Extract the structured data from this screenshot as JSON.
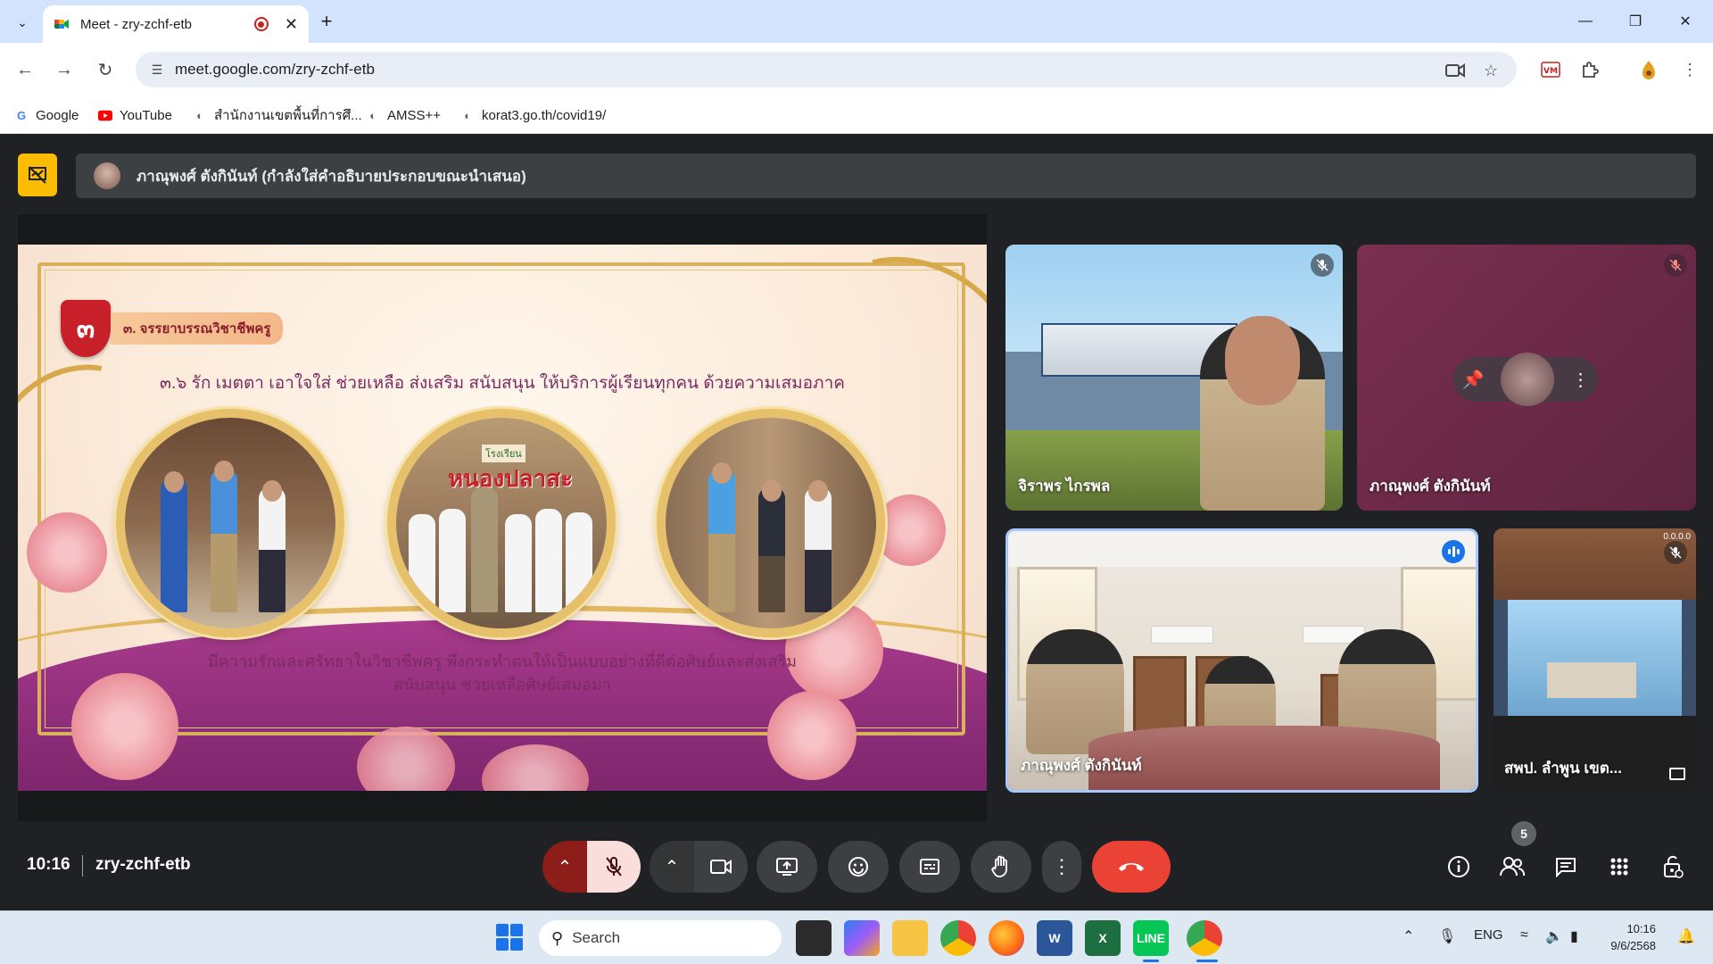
{
  "browser": {
    "tab_title": "Meet - zry-zchf-etb",
    "new_tab": "+",
    "url": "meet.google.com/zry-zchf-etb",
    "bookmarks": [
      {
        "label": "Google",
        "icon": "google-icon"
      },
      {
        "label": "YouTube",
        "icon": "youtube-icon"
      },
      {
        "label": "สำนักงานเขตพื้นที่การศึ...",
        "icon": "globe-icon"
      },
      {
        "label": "AMSS++",
        "icon": "globe-icon"
      },
      {
        "label": "korat3.go.th/covid19/",
        "icon": "globe-icon"
      }
    ]
  },
  "meet": {
    "presenting_banner": "ภาณุพงศ์ ตังกินันท์ (กำลังใส่คำอธิบายประกอบขณะนำเสนอ)",
    "slide": {
      "badge_number": "๓",
      "heading": "๓. จรรยาบรรณวิชาชีพครู",
      "subheading": "๓.๖ รัก เมตตา เอาใจใส่ ช่วยเหลือ ส่งเสริม สนับสนุน ให้บริการผู้เรียนทุกคน ด้วยความเสมอภาค",
      "school_sign": "หนองปลาสะ",
      "school_sign_small": "โรงเรียน",
      "caption_line1": "มีความรักและศรัทธาในวิชาชีพครู พึงกระทำตนให้เป็นแบบอย่างที่ดีต่อศิษย์และส่งเสริม",
      "caption_line2": "สนับสนุน ช่วยเหลือศิษย์เสมอมา"
    },
    "tiles": [
      {
        "name": "จิราพร ไกรพล",
        "muted": true
      },
      {
        "name": "ภาณุพงศ์ ตังกินันท์",
        "muted": true
      },
      {
        "name": "ภาณุพงศ์ ตังกินันท์",
        "speaking": true
      },
      {
        "name": "สพป. ลำพูน เขต...",
        "muted": true,
        "overlay": "0.0.0.0"
      }
    ],
    "clock": "10:16",
    "meeting_code": "zry-zchf-etb",
    "participants_count": "5"
  },
  "taskbar": {
    "search_placeholder": "Search",
    "language": "ENG",
    "time": "10:16",
    "date": "9/6/2568"
  },
  "colors": {
    "meet_bg": "#202124",
    "present_badge": "#fbbc04",
    "end_call": "#ea4335",
    "mic_off_bg": "#f9dedc",
    "tab_strip": "#d3e3fd"
  }
}
